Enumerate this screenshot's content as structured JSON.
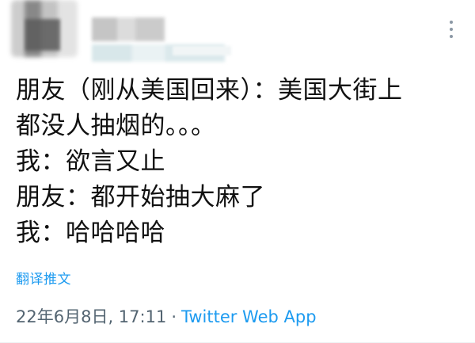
{
  "tweet": {
    "lines": [
      "朋友（刚从美国回来）：美国大街上",
      "都没人抽烟的。。。",
      "我：欲言又止",
      "朋友：都开始抽大麻了",
      "我：哈哈哈哈"
    ],
    "translate_label": "翻译推文",
    "timestamp": "22年6月8日, 17:11",
    "separator": "·",
    "source": "Twitter Web App"
  },
  "icons": {
    "more": "more-vertical-icon"
  },
  "colors": {
    "link": "#1d9bf0",
    "meta": "#536471",
    "text": "#111111"
  }
}
